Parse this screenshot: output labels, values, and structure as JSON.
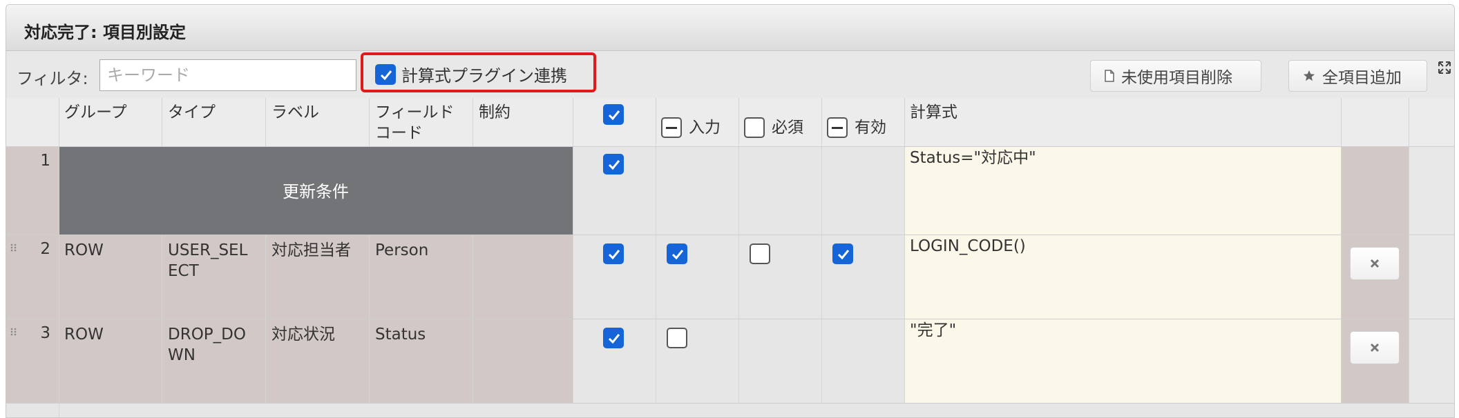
{
  "window": {
    "title": "対応完了: 項目別設定"
  },
  "toolbar": {
    "filter_label": "フィルタ:",
    "filter_placeholder": "キーワード",
    "filter_value": "",
    "calc_plugin_label": "計算式プラグイン連携",
    "calc_plugin_checked": true,
    "delete_unused_label": "未使用項目削除",
    "add_all_label": "全項目追加"
  },
  "columns": {
    "group": "グループ",
    "type": "タイプ",
    "label": "ラベル",
    "field_code_line1": "フィールド",
    "field_code_line2": "コード",
    "constraint": "制約",
    "input": "入力",
    "required": "必須",
    "enabled": "有効",
    "formula": "計算式"
  },
  "rows": [
    {
      "num": "1",
      "section_label": "更新条件",
      "formula": "Status=\"対応中\""
    },
    {
      "num": "2",
      "group": "ROW",
      "type_line1": "USER_SEL",
      "type_line2": "ECT",
      "label": "対応担当者",
      "field_code": "Person",
      "formula": "LOGIN_CODE()"
    },
    {
      "num": "3",
      "group": "ROW",
      "type_line1": "DROP_DO",
      "type_line2": "WN",
      "label": "対応状況",
      "field_code": "Status",
      "formula": "\"完了\""
    }
  ],
  "colors": {
    "accent": "#1565d8",
    "highlight_border": "#e01a1a",
    "section_bg": "#737477",
    "row_bg": "#d2c8c6",
    "formula_bg": "#fbf8ea"
  }
}
